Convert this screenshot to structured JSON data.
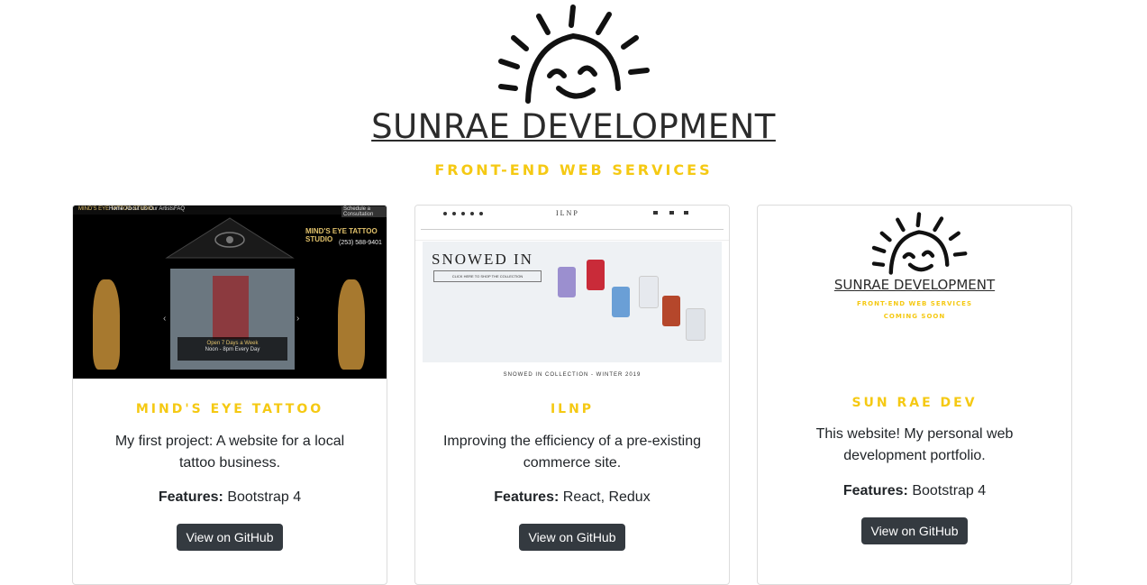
{
  "header": {
    "brand_name": "SUNRAE DEVELOPMENT",
    "tagline": "FRONT-END WEB SERVICES"
  },
  "colors": {
    "accent": "#f5c913",
    "button_bg": "#343a40",
    "text": "#212529"
  },
  "projects": [
    {
      "title": "MIND'S EYE TATTOO",
      "description": "My first project: A website for a local tattoo business.",
      "features_label": "Features:",
      "features_value": "Bootstrap 4",
      "button_label": "View on GitHub",
      "thumbnail": {
        "nav_brand": "MIND'S EYE TATTOO STUDIO",
        "nav_items": [
          "Home",
          "About Us",
          "Our Artists",
          "FAQ"
        ],
        "nav_cta": "Schedule a Consultation",
        "logo_text": "MIND'S EYE TATTOO STUDIO",
        "phone": "(253) 588-9401",
        "banner_line1": "Open 7 Days a Week",
        "banner_line2": "Noon - 8pm Every Day"
      }
    },
    {
      "title": "ILNP",
      "description": "Improving the efficiency of a pre-existing commerce site.",
      "features_label": "Features:",
      "features_value": "React, Redux",
      "button_label": "View on GitHub",
      "thumbnail": {
        "logo_text": "ILNP",
        "hero_text": "SNOWED IN",
        "hero_button": "CLICK HERE TO SHOP THE COLLECTION",
        "caption": "SNOWED IN COLLECTION - WINTER 2019"
      }
    },
    {
      "title": "SUN RAE DEV",
      "description": "This website! My personal web development portfolio.",
      "features_label": "Features:",
      "features_value": "Bootstrap 4",
      "button_label": "View on GitHub",
      "thumbnail": {
        "brand_name": "SUNRAE DEVELOPMENT",
        "tagline": "FRONT-END WEB SERVICES",
        "status": "COMING SOON"
      }
    }
  ]
}
